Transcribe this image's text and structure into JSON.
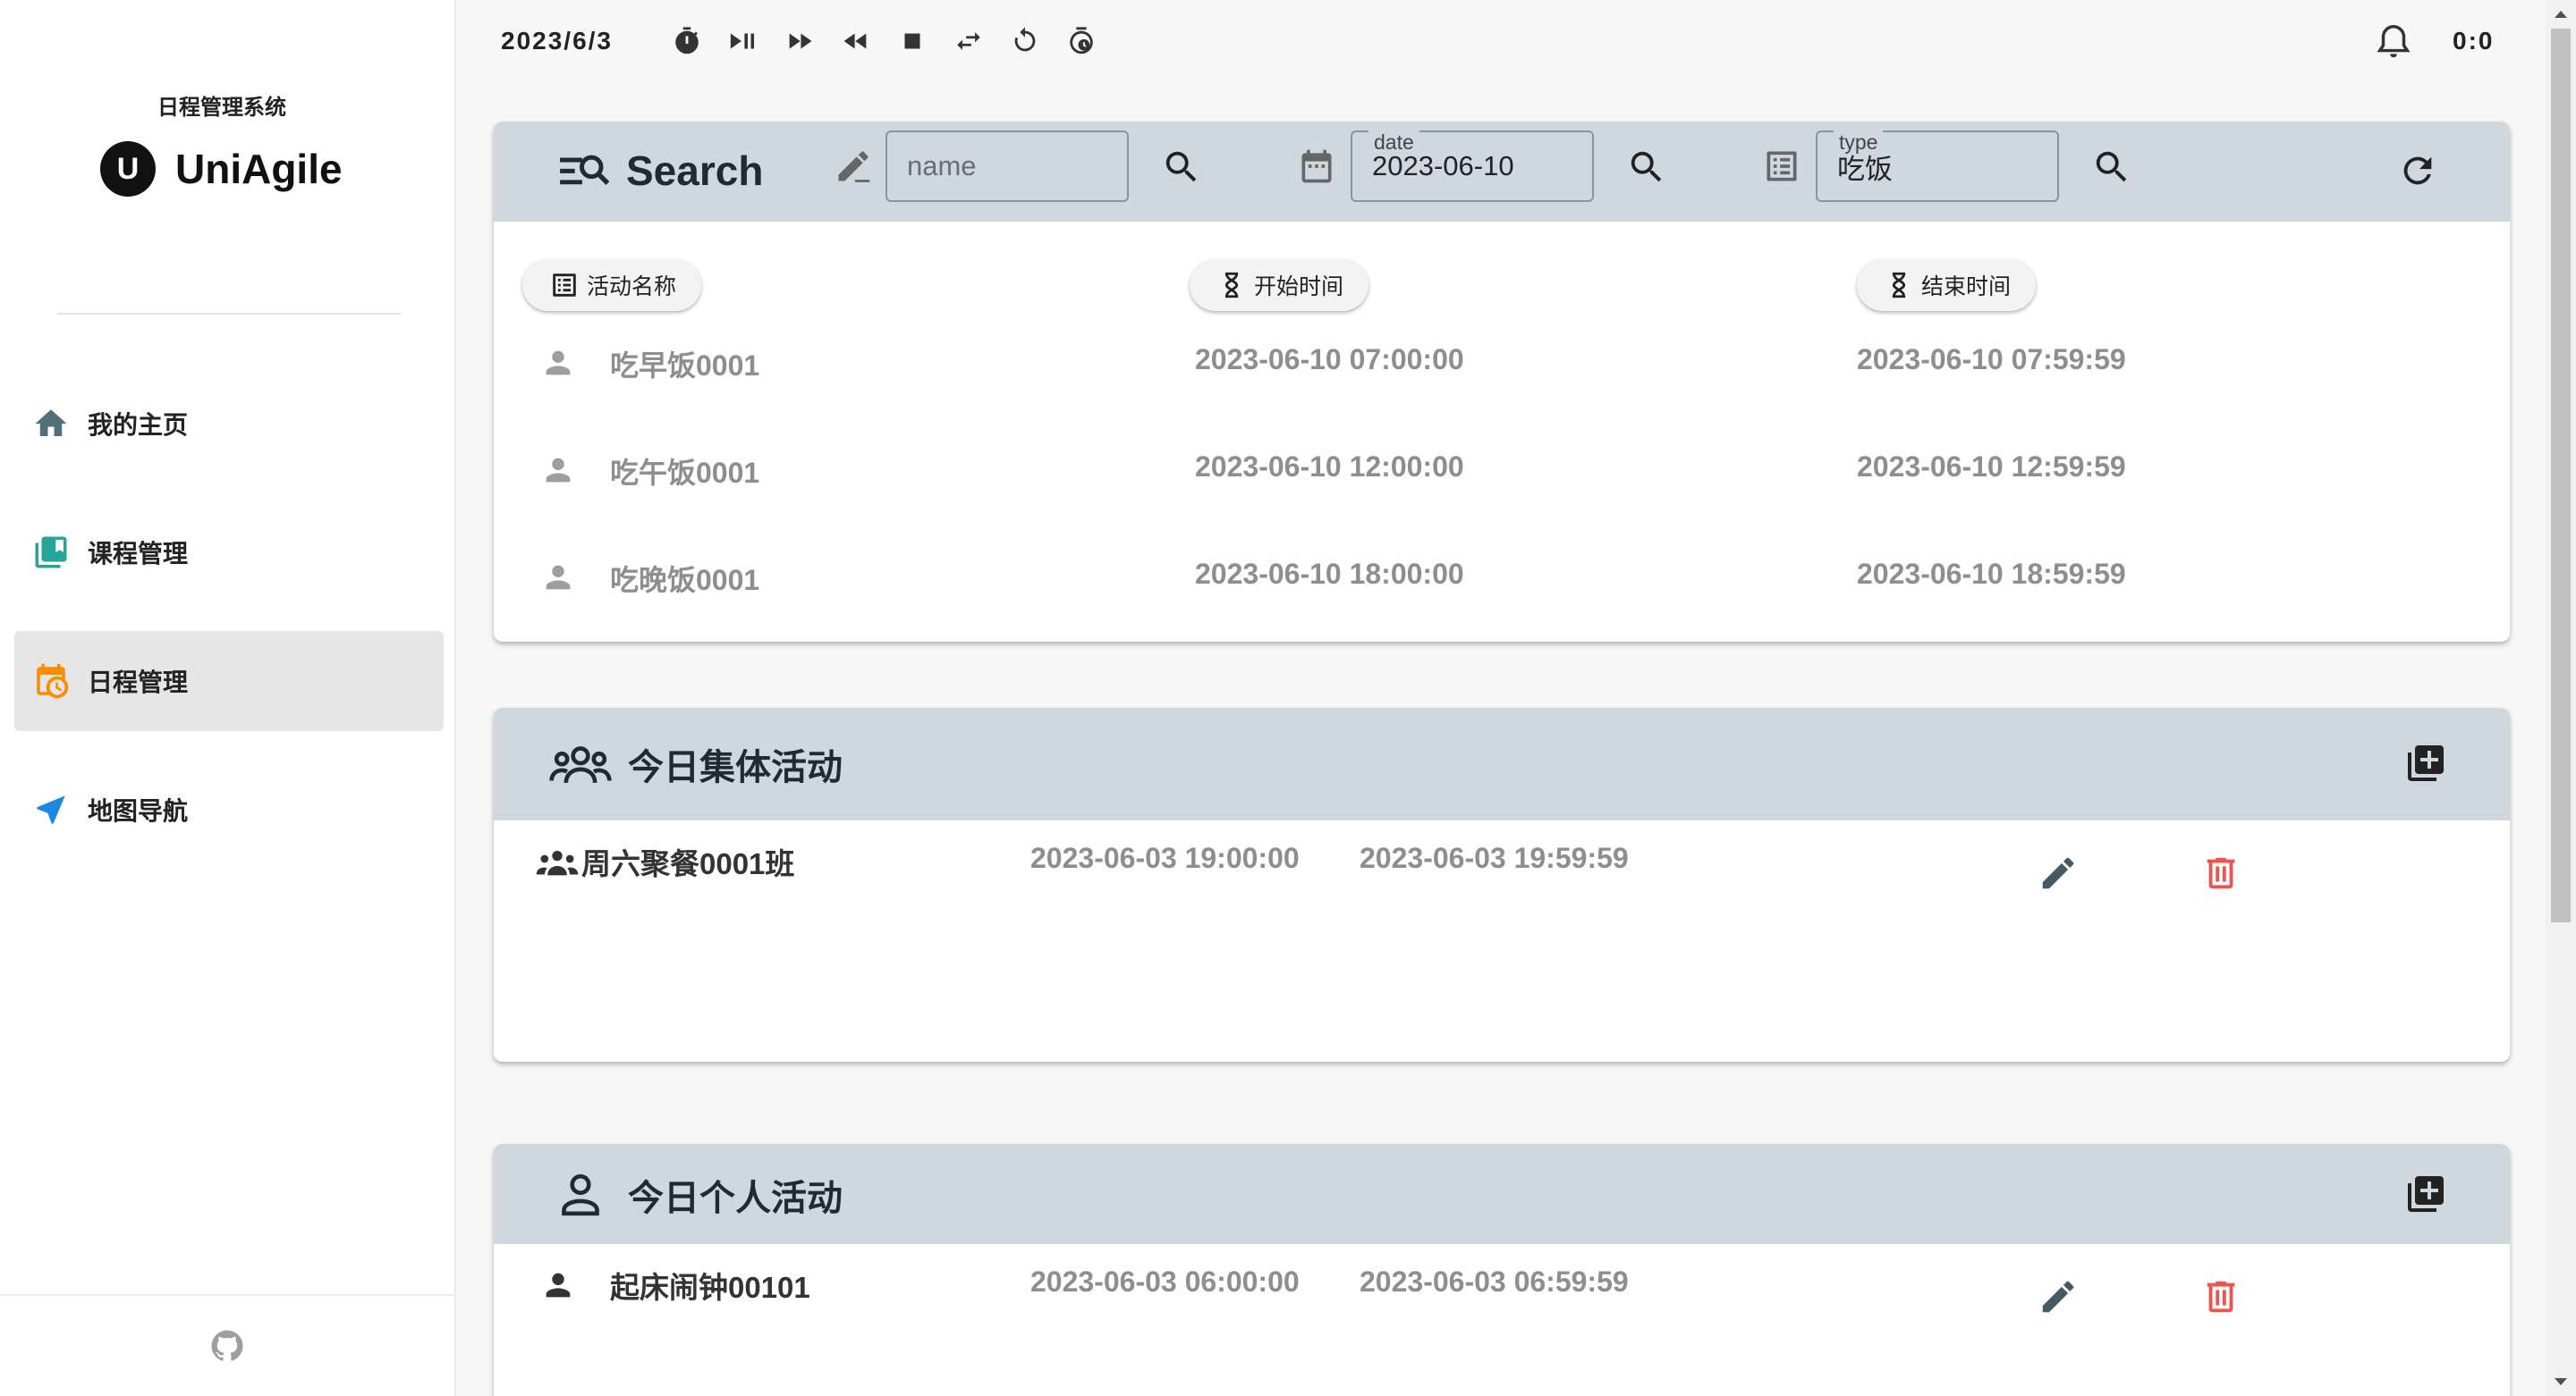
{
  "sidebar": {
    "subtitle": "日程管理系统",
    "logo_letter": "U",
    "app_name": "UniAgile",
    "nav": [
      {
        "label": "我的主页",
        "icon": "home-icon",
        "color": "#546e7a"
      },
      {
        "label": "课程管理",
        "icon": "book-icon",
        "color": "#26a69a"
      },
      {
        "label": "日程管理",
        "icon": "calendar-clock-icon",
        "color": "#fb8c00",
        "active": true
      },
      {
        "label": "地图导航",
        "icon": "navigation-icon",
        "color": "#1e88e5"
      }
    ],
    "footer_icon": "github-icon"
  },
  "topbar": {
    "date": "2023/6/3",
    "controls": [
      "timer-icon",
      "play-pause-icon",
      "fast-forward-icon",
      "rewind-icon",
      "stop-icon",
      "swap-icon",
      "restart-icon",
      "timer-history-icon"
    ],
    "bell_icon": "bell-icon",
    "time": "0:0"
  },
  "search": {
    "title": "Search",
    "name_field": {
      "placeholder": "name",
      "value": ""
    },
    "date_field": {
      "legend": "date",
      "value": "2023-06-10"
    },
    "type_field": {
      "legend": "type",
      "value": "吃饭"
    },
    "columns": [
      "活动名称",
      "开始时间",
      "结束时间"
    ],
    "results": [
      {
        "name": "吃早饭0001",
        "start": "2023-06-10 07:00:00",
        "end": "2023-06-10 07:59:59"
      },
      {
        "name": "吃午饭0001",
        "start": "2023-06-10 12:00:00",
        "end": "2023-06-10 12:59:59"
      },
      {
        "name": "吃晚饭0001",
        "start": "2023-06-10 18:00:00",
        "end": "2023-06-10 18:59:59"
      }
    ]
  },
  "group_activities": {
    "title": "今日集体活动",
    "items": [
      {
        "name": "周六聚餐0001班",
        "start": "2023-06-03 19:00:00",
        "end": "2023-06-03 19:59:59"
      }
    ]
  },
  "personal_activities": {
    "title": "今日个人活动",
    "items": [
      {
        "name": "起床闹钟00101",
        "start": "2023-06-03 06:00:00",
        "end": "2023-06-03 06:59:59"
      }
    ]
  },
  "colors": {
    "accent_header": "#cfd8df",
    "delete": "#ef5350",
    "muted_text": "#8e8e8e"
  }
}
